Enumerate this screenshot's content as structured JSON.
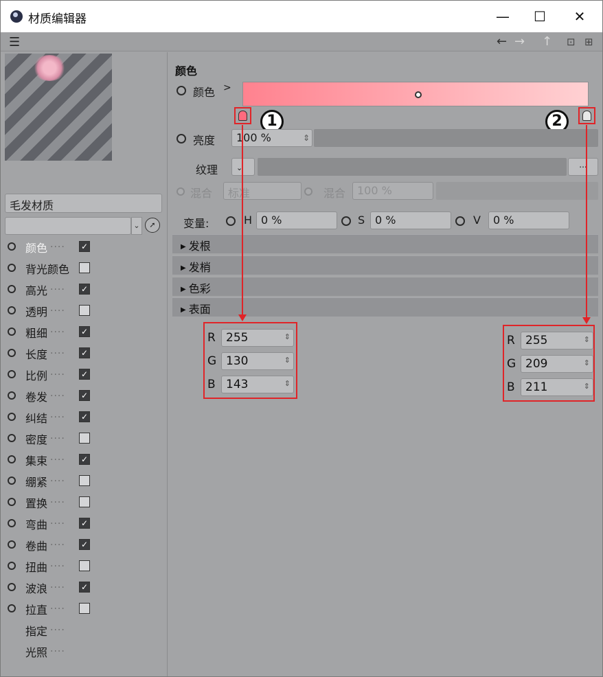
{
  "window": {
    "title": "材质编辑器",
    "minimize": "—",
    "maximize": "☐",
    "close": "✕"
  },
  "menubar": {
    "menu_icon": "hamburger-icon",
    "back": "←",
    "forward": "→",
    "up": "↑",
    "lock": "🔒",
    "new": "⊞"
  },
  "left": {
    "material_name": "毛发材质",
    "channels": [
      {
        "label": "颜色",
        "checked": true,
        "active": true
      },
      {
        "label": "背光颜色",
        "checked": false
      },
      {
        "label": "高光",
        "checked": true
      },
      {
        "label": "透明",
        "checked": false
      },
      {
        "label": "粗细",
        "checked": true
      },
      {
        "label": "长度",
        "checked": true
      },
      {
        "label": "比例",
        "checked": true
      },
      {
        "label": "卷发",
        "checked": true
      },
      {
        "label": "纠结",
        "checked": true
      },
      {
        "label": "密度",
        "checked": false
      },
      {
        "label": "集束",
        "checked": true
      },
      {
        "label": "绷紧",
        "checked": false
      },
      {
        "label": "置换",
        "checked": false
      },
      {
        "label": "弯曲",
        "checked": true
      },
      {
        "label": "卷曲",
        "checked": true
      },
      {
        "label": "扭曲",
        "checked": false
      },
      {
        "label": "波浪",
        "checked": true
      },
      {
        "label": "拉直",
        "checked": false
      },
      {
        "label": "指定",
        "no_control": true
      },
      {
        "label": "光照",
        "no_control": true
      }
    ]
  },
  "right": {
    "section_title": "颜色",
    "color_label": "颜色",
    "color_chevron": ">",
    "brightness_label": "亮度",
    "brightness_value": "100 %",
    "texture_label": "纹理",
    "texture_more": "...",
    "mix_label": "混合",
    "mix_mode": "标准",
    "mix_label2": "混合",
    "mix_value": "100 %",
    "variation_label": "变量:",
    "h_label": "H",
    "h_value": "0 %",
    "s_label": "S",
    "s_value": "0 %",
    "v_label": "V",
    "v_value": "0 %",
    "sections": [
      "发根",
      "发梢",
      "色彩",
      "表面"
    ],
    "badge1": "1",
    "badge2": "2",
    "gradient": {
      "start_color": "#ff828f",
      "end_color": "#ffd1d3"
    },
    "stop1": {
      "R": "255",
      "G": "130",
      "B": "143"
    },
    "stop2": {
      "R": "255",
      "G": "209",
      "B": "211"
    },
    "rgb_labels": {
      "R": "R",
      "G": "G",
      "B": "B"
    }
  },
  "colors": {
    "annotation_red": "#e02428",
    "panel_bg": "#a3a4a6"
  }
}
